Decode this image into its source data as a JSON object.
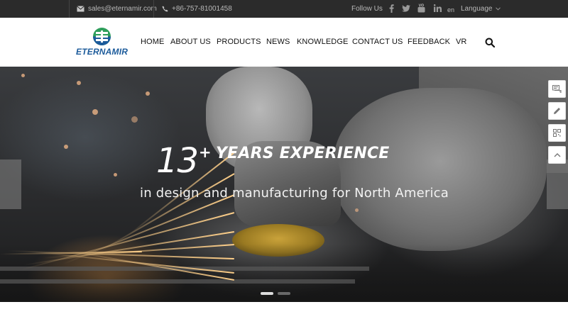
{
  "topbar": {
    "email": "sales@eternamir.com",
    "phone": "+86-757-81001458",
    "follow_label": "Follow Us",
    "social_icons": [
      "facebook-icon",
      "twitter-icon",
      "youtube-icon",
      "linkedin-icon"
    ],
    "lang_code": "en",
    "language_label": "Language"
  },
  "brand": {
    "name": "ETERNAMIR",
    "color": "#1c5b9b",
    "accent": "#2e9e5b"
  },
  "nav": {
    "items": [
      "HOME",
      "ABOUT US",
      "PRODUCTS",
      "NEWS",
      "KNOWLEDGE",
      "CONTACT US",
      "FEEDBACK",
      "VR"
    ]
  },
  "hero": {
    "number": "13",
    "plus": "+",
    "title": "YEARS EXPERIENCE",
    "subtitle": "in design and manufacturing for North America",
    "slides": [
      true,
      false,
      false
    ]
  },
  "float_tools": [
    "chat-icon",
    "edit-icon",
    "qr-code-icon",
    "scroll-top-icon"
  ]
}
